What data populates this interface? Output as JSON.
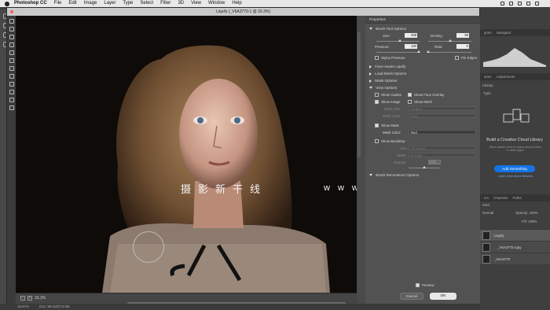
{
  "menubar": {
    "app_name": "Photoshop CC",
    "items": [
      "File",
      "Edit",
      "Image",
      "Layer",
      "Type",
      "Select",
      "Filter",
      "3D",
      "View",
      "Window",
      "Help"
    ]
  },
  "liquify": {
    "title": "Liquify (_V6A3770-1 @ 33.3%)",
    "zoom": "33.3%",
    "watermark_cn": "摄影新干线",
    "watermark_url": "www.photosks.vip",
    "properties_title": "Properties",
    "brush_tool_options": {
      "header": "Brush Tool Options",
      "size_label": "Size:",
      "size_value": "338",
      "density_label": "Density:",
      "density_value": "50",
      "pressure_label": "Pressure:",
      "pressure_value": "100",
      "rate_label": "Rate:",
      "rate_value": "0",
      "stylus_pressure": "Stylus Pressure",
      "pin_edges": "Pin Edges"
    },
    "collapsed_sections": [
      "Face-Aware Liquify",
      "Load Mesh Options",
      "Mask Options"
    ],
    "view_options": {
      "header": "View Options",
      "show_guides": "Show Guides",
      "show_face_overlay": "Show Face Overlay",
      "show_image": "Show Image",
      "show_mesh": "Show Mesh",
      "mesh_size_label": "Mesh Size:",
      "mesh_size_value": "Medium",
      "mesh_color_label": "Mesh Color:",
      "mesh_color_value": "Gray",
      "show_mask": "Show Mask",
      "mask_color_label": "Mask Color:",
      "mask_color_value": "Red",
      "show_backdrop": "Show Backdrop",
      "use_label": "Use:",
      "use_value": "All Layers",
      "mode_label": "Mode:",
      "mode_value": "In Front",
      "opacity_label": "Opacity:",
      "opacity_value": "50"
    },
    "brush_reconstruct": "Brush Reconstruct Options",
    "preview_label": "Preview",
    "cancel_label": "Cancel",
    "ok_label": "OK"
  },
  "right_panel": {
    "tabs_top": [
      "gram",
      "Navigator"
    ],
    "tabs_mid": [
      "aries",
      "Adjustments"
    ],
    "library_label": "Library",
    "type_label": "Type",
    "cloud_title": "Build a Creative Cloud Library",
    "cloud_desc": "Save assets here to easily access them in other apps.",
    "add_button": "Add Something",
    "learn_more": "Learn more about libraries",
    "tabs_layers": [
      "ers",
      "Channels",
      "Paths"
    ],
    "kind_label": "Kind",
    "normal_label": "Normal",
    "opacity_label": "Opacity:",
    "opacity_value": "100%",
    "fill_label": "Fill:",
    "fill_value": "100%",
    "layers": [
      "Liquify",
      "_V6A3770 copy",
      "_V6A3770"
    ]
  },
  "status": {
    "zoom": "16.67%",
    "doc": "Doc: 98.1M/274.5M"
  }
}
